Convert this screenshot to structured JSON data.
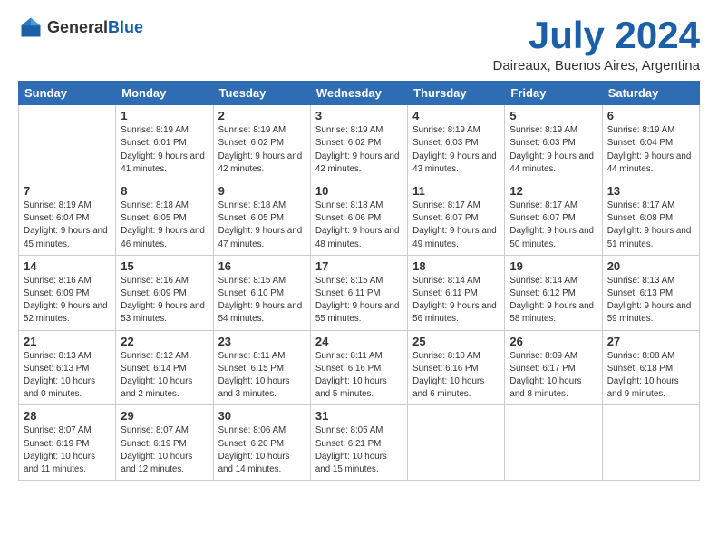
{
  "header": {
    "logo_general": "General",
    "logo_blue": "Blue",
    "title": "July 2024",
    "location": "Daireaux, Buenos Aires, Argentina"
  },
  "weekdays": [
    "Sunday",
    "Monday",
    "Tuesday",
    "Wednesday",
    "Thursday",
    "Friday",
    "Saturday"
  ],
  "weeks": [
    [
      {
        "day": "",
        "sunrise": "",
        "sunset": "",
        "daylight": ""
      },
      {
        "day": "1",
        "sunrise": "Sunrise: 8:19 AM",
        "sunset": "Sunset: 6:01 PM",
        "daylight": "Daylight: 9 hours and 41 minutes."
      },
      {
        "day": "2",
        "sunrise": "Sunrise: 8:19 AM",
        "sunset": "Sunset: 6:02 PM",
        "daylight": "Daylight: 9 hours and 42 minutes."
      },
      {
        "day": "3",
        "sunrise": "Sunrise: 8:19 AM",
        "sunset": "Sunset: 6:02 PM",
        "daylight": "Daylight: 9 hours and 42 minutes."
      },
      {
        "day": "4",
        "sunrise": "Sunrise: 8:19 AM",
        "sunset": "Sunset: 6:03 PM",
        "daylight": "Daylight: 9 hours and 43 minutes."
      },
      {
        "day": "5",
        "sunrise": "Sunrise: 8:19 AM",
        "sunset": "Sunset: 6:03 PM",
        "daylight": "Daylight: 9 hours and 44 minutes."
      },
      {
        "day": "6",
        "sunrise": "Sunrise: 8:19 AM",
        "sunset": "Sunset: 6:04 PM",
        "daylight": "Daylight: 9 hours and 44 minutes."
      }
    ],
    [
      {
        "day": "7",
        "sunrise": "Sunrise: 8:19 AM",
        "sunset": "Sunset: 6:04 PM",
        "daylight": "Daylight: 9 hours and 45 minutes."
      },
      {
        "day": "8",
        "sunrise": "Sunrise: 8:18 AM",
        "sunset": "Sunset: 6:05 PM",
        "daylight": "Daylight: 9 hours and 46 minutes."
      },
      {
        "day": "9",
        "sunrise": "Sunrise: 8:18 AM",
        "sunset": "Sunset: 6:05 PM",
        "daylight": "Daylight: 9 hours and 47 minutes."
      },
      {
        "day": "10",
        "sunrise": "Sunrise: 8:18 AM",
        "sunset": "Sunset: 6:06 PM",
        "daylight": "Daylight: 9 hours and 48 minutes."
      },
      {
        "day": "11",
        "sunrise": "Sunrise: 8:17 AM",
        "sunset": "Sunset: 6:07 PM",
        "daylight": "Daylight: 9 hours and 49 minutes."
      },
      {
        "day": "12",
        "sunrise": "Sunrise: 8:17 AM",
        "sunset": "Sunset: 6:07 PM",
        "daylight": "Daylight: 9 hours and 50 minutes."
      },
      {
        "day": "13",
        "sunrise": "Sunrise: 8:17 AM",
        "sunset": "Sunset: 6:08 PM",
        "daylight": "Daylight: 9 hours and 51 minutes."
      }
    ],
    [
      {
        "day": "14",
        "sunrise": "Sunrise: 8:16 AM",
        "sunset": "Sunset: 6:09 PM",
        "daylight": "Daylight: 9 hours and 52 minutes."
      },
      {
        "day": "15",
        "sunrise": "Sunrise: 8:16 AM",
        "sunset": "Sunset: 6:09 PM",
        "daylight": "Daylight: 9 hours and 53 minutes."
      },
      {
        "day": "16",
        "sunrise": "Sunrise: 8:15 AM",
        "sunset": "Sunset: 6:10 PM",
        "daylight": "Daylight: 9 hours and 54 minutes."
      },
      {
        "day": "17",
        "sunrise": "Sunrise: 8:15 AM",
        "sunset": "Sunset: 6:11 PM",
        "daylight": "Daylight: 9 hours and 55 minutes."
      },
      {
        "day": "18",
        "sunrise": "Sunrise: 8:14 AM",
        "sunset": "Sunset: 6:11 PM",
        "daylight": "Daylight: 9 hours and 56 minutes."
      },
      {
        "day": "19",
        "sunrise": "Sunrise: 8:14 AM",
        "sunset": "Sunset: 6:12 PM",
        "daylight": "Daylight: 9 hours and 58 minutes."
      },
      {
        "day": "20",
        "sunrise": "Sunrise: 8:13 AM",
        "sunset": "Sunset: 6:13 PM",
        "daylight": "Daylight: 9 hours and 59 minutes."
      }
    ],
    [
      {
        "day": "21",
        "sunrise": "Sunrise: 8:13 AM",
        "sunset": "Sunset: 6:13 PM",
        "daylight": "Daylight: 10 hours and 0 minutes."
      },
      {
        "day": "22",
        "sunrise": "Sunrise: 8:12 AM",
        "sunset": "Sunset: 6:14 PM",
        "daylight": "Daylight: 10 hours and 2 minutes."
      },
      {
        "day": "23",
        "sunrise": "Sunrise: 8:11 AM",
        "sunset": "Sunset: 6:15 PM",
        "daylight": "Daylight: 10 hours and 3 minutes."
      },
      {
        "day": "24",
        "sunrise": "Sunrise: 8:11 AM",
        "sunset": "Sunset: 6:16 PM",
        "daylight": "Daylight: 10 hours and 5 minutes."
      },
      {
        "day": "25",
        "sunrise": "Sunrise: 8:10 AM",
        "sunset": "Sunset: 6:16 PM",
        "daylight": "Daylight: 10 hours and 6 minutes."
      },
      {
        "day": "26",
        "sunrise": "Sunrise: 8:09 AM",
        "sunset": "Sunset: 6:17 PM",
        "daylight": "Daylight: 10 hours and 8 minutes."
      },
      {
        "day": "27",
        "sunrise": "Sunrise: 8:08 AM",
        "sunset": "Sunset: 6:18 PM",
        "daylight": "Daylight: 10 hours and 9 minutes."
      }
    ],
    [
      {
        "day": "28",
        "sunrise": "Sunrise: 8:07 AM",
        "sunset": "Sunset: 6:19 PM",
        "daylight": "Daylight: 10 hours and 11 minutes."
      },
      {
        "day": "29",
        "sunrise": "Sunrise: 8:07 AM",
        "sunset": "Sunset: 6:19 PM",
        "daylight": "Daylight: 10 hours and 12 minutes."
      },
      {
        "day": "30",
        "sunrise": "Sunrise: 8:06 AM",
        "sunset": "Sunset: 6:20 PM",
        "daylight": "Daylight: 10 hours and 14 minutes."
      },
      {
        "day": "31",
        "sunrise": "Sunrise: 8:05 AM",
        "sunset": "Sunset: 6:21 PM",
        "daylight": "Daylight: 10 hours and 15 minutes."
      },
      {
        "day": "",
        "sunrise": "",
        "sunset": "",
        "daylight": ""
      },
      {
        "day": "",
        "sunrise": "",
        "sunset": "",
        "daylight": ""
      },
      {
        "day": "",
        "sunrise": "",
        "sunset": "",
        "daylight": ""
      }
    ]
  ]
}
